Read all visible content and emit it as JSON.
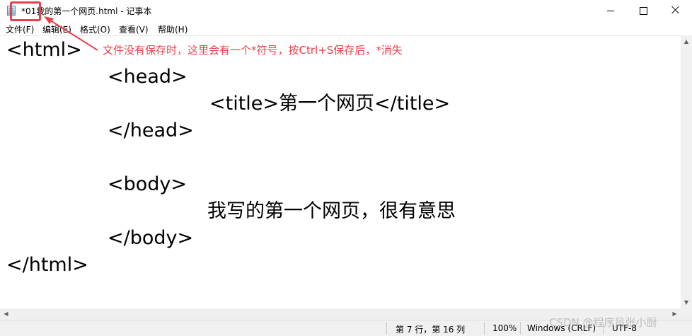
{
  "window": {
    "title": "*01我的第一个网页.html - 记事本",
    "controls": {
      "minimize": "minimize",
      "maximize": "maximize",
      "close": "close"
    }
  },
  "menu": {
    "items": [
      {
        "label": "文件(F)"
      },
      {
        "label": "编辑(E)"
      },
      {
        "label": "格式(O)"
      },
      {
        "label": "查看(V)"
      },
      {
        "label": "帮助(H)"
      }
    ]
  },
  "editor": {
    "lines": [
      "<html>",
      "<head>",
      "<title>第一个网页</title>",
      "</head>",
      "",
      "<body>",
      "我写的第一个网页，很有意思",
      "</body>",
      "</html>"
    ]
  },
  "status": {
    "position": "第 7 行，第 16 列",
    "zoom": "100%",
    "line_ending": "Windows (CRLF)",
    "encoding": "UTF-8"
  },
  "annotation": {
    "text": "文件没有保存时，这里会有一个*符号，按Ctrl+S保存后，*消失",
    "color": "#e8414c"
  },
  "watermark": "CSDN @程序员张小厨",
  "icons": {
    "app": "notepad-icon",
    "scroll_up": "arrow-up-icon",
    "scroll_down": "arrow-down-icon",
    "scroll_left": "arrow-left-icon",
    "scroll_right": "arrow-right-icon"
  }
}
